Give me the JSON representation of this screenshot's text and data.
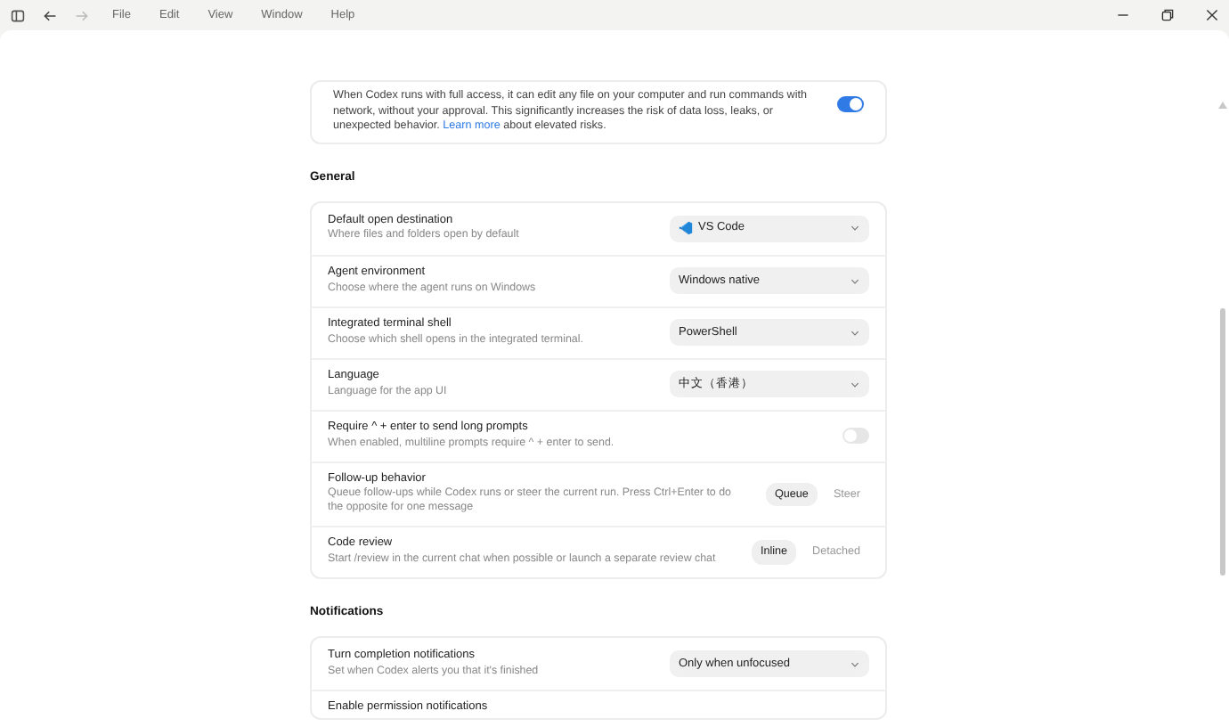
{
  "titlebar": {
    "menus": [
      "File",
      "Edit",
      "View",
      "Window",
      "Help"
    ]
  },
  "intro_card": {
    "text_before": "When Codex runs with full access, it can edit any file on your computer and run commands with network, without your approval. This significantly increases the risk of data loss, leaks, or unexpected behavior.",
    "link": "Learn more",
    "text_after": "about elevated risks.",
    "toggle_on": true
  },
  "sections": [
    {
      "title": "General",
      "rows": [
        {
          "kind": "select",
          "title": "Default open destination",
          "description": "Where files and folders open by default",
          "value": "VS Code",
          "value_has_icon": true
        },
        {
          "kind": "select",
          "title": "Agent environment",
          "description": "Choose where the agent runs on Windows",
          "value": "Windows native"
        },
        {
          "kind": "select",
          "title": "Integrated terminal shell",
          "description": "Choose which shell opens in the integrated terminal.",
          "value": "PowerShell"
        },
        {
          "kind": "select",
          "title": "Language",
          "description": "Language for the app UI",
          "value": "中文（香港）"
        },
        {
          "kind": "toggle",
          "title": "Require ^ + enter to send long prompts",
          "description": "When enabled, multiline prompts require ^ + enter to send.",
          "on": false
        },
        {
          "kind": "segmented",
          "title": "Follow-up behavior",
          "description": "Queue follow-ups while Codex runs or steer the current run. Press Ctrl+Enter to do the opposite for one message",
          "options": [
            {
              "label": "Queue",
              "selected": true
            },
            {
              "label": "Steer",
              "selected": false
            }
          ]
        },
        {
          "kind": "segmented",
          "title": "Code review",
          "description": "Start /review in the current chat when possible or launch a separate review chat",
          "options": [
            {
              "label": "Inline",
              "selected": true
            },
            {
              "label": "Detached",
              "selected": false
            }
          ]
        }
      ]
    },
    {
      "title": "Notifications",
      "rows": [
        {
          "kind": "select",
          "title": "Turn completion notifications",
          "description": "Set when Codex alerts you that it's finished",
          "value": "Only when unfocused"
        },
        {
          "kind": "title",
          "title": "Enable permission notifications"
        }
      ]
    }
  ]
}
